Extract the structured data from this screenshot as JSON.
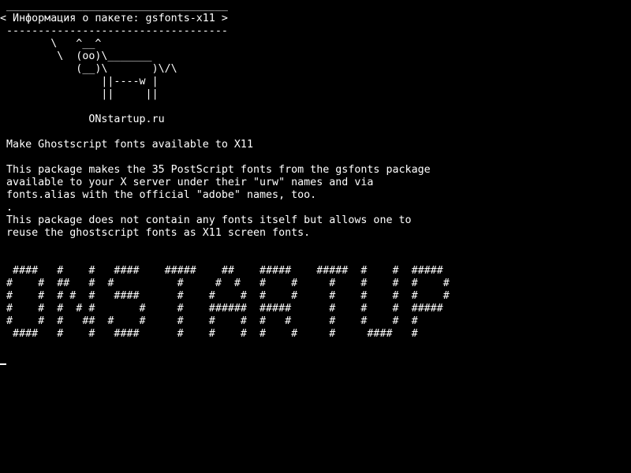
{
  "terminal": {
    "background": "#000000",
    "foreground": "#ffffff",
    "speech_bubble": {
      "top_border": " ___________________________________",
      "text": "< Информация о пакете: gsfonts-x11 >",
      "bottom_border": " -----------------------------------"
    },
    "cow": [
      "        \\   ^__^",
      "         \\  (oo)\\_______",
      "            (__)\\       )\\/\\",
      "                ||----w |",
      "                ||     ||"
    ],
    "site": "              ONstartup.ru",
    "package_summary": " Make Ghostscript fonts available to X11",
    "description": [
      " This package makes the 35 PostScript fonts from the gsfonts package",
      " available to your X server under their \"urw\" names and via",
      " fonts.alias with the official \"adobe\" names, too.",
      " .",
      " This package does not contain any fonts itself but allows one to",
      " reuse the ghostscript fonts as X11 screen fonts."
    ],
    "banner": [
      "  ####   #    #   ####    #####    ##    #####    #####  #    #  #####",
      " #    #  ##   #  #          #     #  #   #    #     #    #    #  #    #",
      " #    #  # #  #   ####      #    #    #  #    #     #    #    #  #    #",
      " #    #  #  # #       #     #    ######  #####      #    #    #  #####",
      " #    #  #   ##  #    #     #    #    #  #   #      #    #    #  #",
      "  ####   #    #   ####      #    #    #  #    #     #     ####   #"
    ]
  }
}
